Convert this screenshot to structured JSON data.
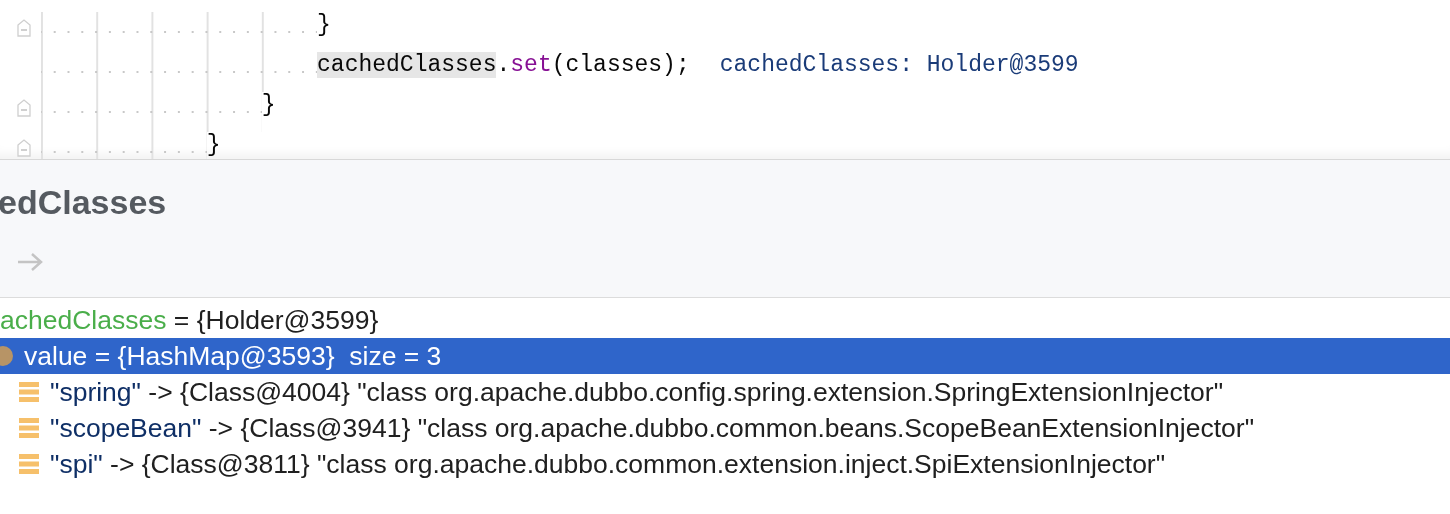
{
  "editor": {
    "lines": [
      {
        "fold": true,
        "segments": [
          {
            "kind": "plain",
            "text": "                    }"
          }
        ]
      },
      {
        "fold": false,
        "segments": [
          {
            "kind": "highlight",
            "text": "                    cachedClasses"
          },
          {
            "kind": "plain",
            "text": "."
          },
          {
            "kind": "method",
            "text": "set"
          },
          {
            "kind": "plain",
            "text": "(classes);"
          },
          {
            "kind": "hint",
            "text": "cachedClasses: Holder@3599"
          }
        ]
      },
      {
        "fold": true,
        "segments": [
          {
            "kind": "plain",
            "text": "                }"
          }
        ]
      },
      {
        "fold": true,
        "segments": [
          {
            "kind": "plain",
            "text": "            }"
          }
        ]
      }
    ]
  },
  "panel": {
    "title": "edClasses",
    "tree": [
      {
        "name": "achedClasses",
        "value": " = {Holder@3599}",
        "selected": false,
        "children": [
          {
            "kind": "object",
            "name": "value",
            "value": " = {HashMap@3593}  size = 3",
            "selected": true,
            "children": [
              {
                "kind": "entry",
                "key": "\"spring\"",
                "value": " -> {Class@4004} \"class org.apache.dubbo.config.spring.extension.SpringExtensionInjector\"",
                "selected": false
              },
              {
                "kind": "entry",
                "key": "\"scopeBean\"",
                "value": " -> {Class@3941} \"class org.apache.dubbo.common.beans.ScopeBeanExtensionInjector\"",
                "selected": false
              },
              {
                "kind": "entry",
                "key": "\"spi\"",
                "value": " -> {Class@3811} \"class org.apache.dubbo.common.extension.inject.SpiExtensionInjector\"",
                "selected": false
              }
            ]
          }
        ]
      }
    ]
  }
}
